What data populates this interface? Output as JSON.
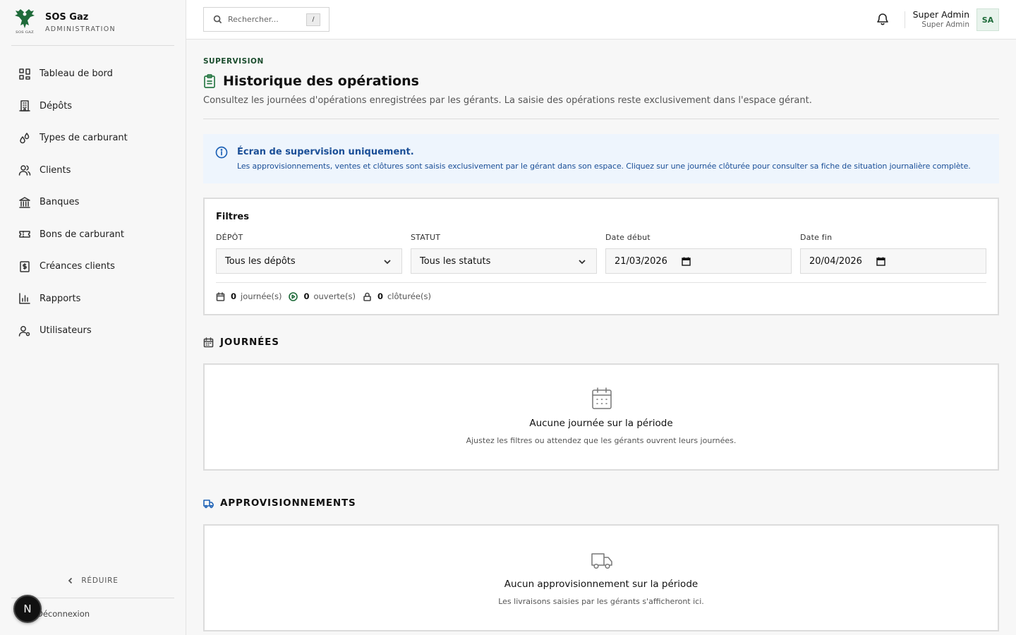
{
  "brand": {
    "name": "SOS Gaz",
    "subtitle": "ADMINISTRATION",
    "logo_text": "SOS GAZ"
  },
  "sidebar": {
    "items": [
      {
        "label": "Tableau de bord",
        "icon": "grid-icon"
      },
      {
        "label": "Dépôts",
        "icon": "building-icon"
      },
      {
        "label": "Types de carburant",
        "icon": "drops-icon"
      },
      {
        "label": "Clients",
        "icon": "users-icon"
      },
      {
        "label": "Banques",
        "icon": "bank-icon"
      },
      {
        "label": "Bons de carburant",
        "icon": "ticket-icon"
      },
      {
        "label": "Créances clients",
        "icon": "receipt-icon"
      },
      {
        "label": "Rapports",
        "icon": "bar-chart-icon"
      },
      {
        "label": "Utilisateurs",
        "icon": "user-cog-icon"
      }
    ],
    "collapse_label": "RÉDUIRE",
    "logout_label": "Déconnexion",
    "bubble_letter": "N"
  },
  "topbar": {
    "search_placeholder": "Rechercher...",
    "search_shortcut": "/",
    "user_name": "Super Admin",
    "user_role": "Super Admin",
    "avatar_initials": "SA"
  },
  "page": {
    "eyebrow": "SUPERVISION",
    "title": "Historique des opérations",
    "description": "Consultez les journées d'opérations enregistrées par les gérants. La saisie des opérations reste exclusivement dans l'espace gérant."
  },
  "info": {
    "title": "Écran de supervision uniquement.",
    "text": "Les approvisionnements, ventes et clôtures sont saisis exclusivement par le gérant dans son espace. Cliquez sur une journée clôturée pour consulter sa fiche de situation journalière complète."
  },
  "filters": {
    "title": "Filtres",
    "depot_label": "DÉPÔT",
    "depot_value": "Tous les dépôts",
    "status_label": "STATUT",
    "status_value": "Tous les statuts",
    "start_label": "Date début",
    "start_value": "21/03/2026",
    "end_label": "Date fin",
    "end_value": "20/04/2026",
    "counts": [
      {
        "value": "0",
        "label": "journée(s)"
      },
      {
        "value": "0",
        "label": "ouverte(s)"
      },
      {
        "value": "0",
        "label": "clôturée(s)"
      }
    ]
  },
  "sections": {
    "days": {
      "title": "JOURNÉES",
      "empty_title": "Aucune journée sur la période",
      "empty_text": "Ajustez les filtres ou attendez que les gérants ouvrent leurs journées."
    },
    "supplies": {
      "title": "APPROVISIONNEMENTS",
      "empty_title": "Aucun approvisionnement sur la période",
      "empty_text": "Les livraisons saisies par les gérants s'afficheront ici."
    }
  },
  "colors": {
    "accent_green": "#1f6b3a",
    "info_bg": "#eef5fd",
    "info_text": "#1b4f97"
  }
}
